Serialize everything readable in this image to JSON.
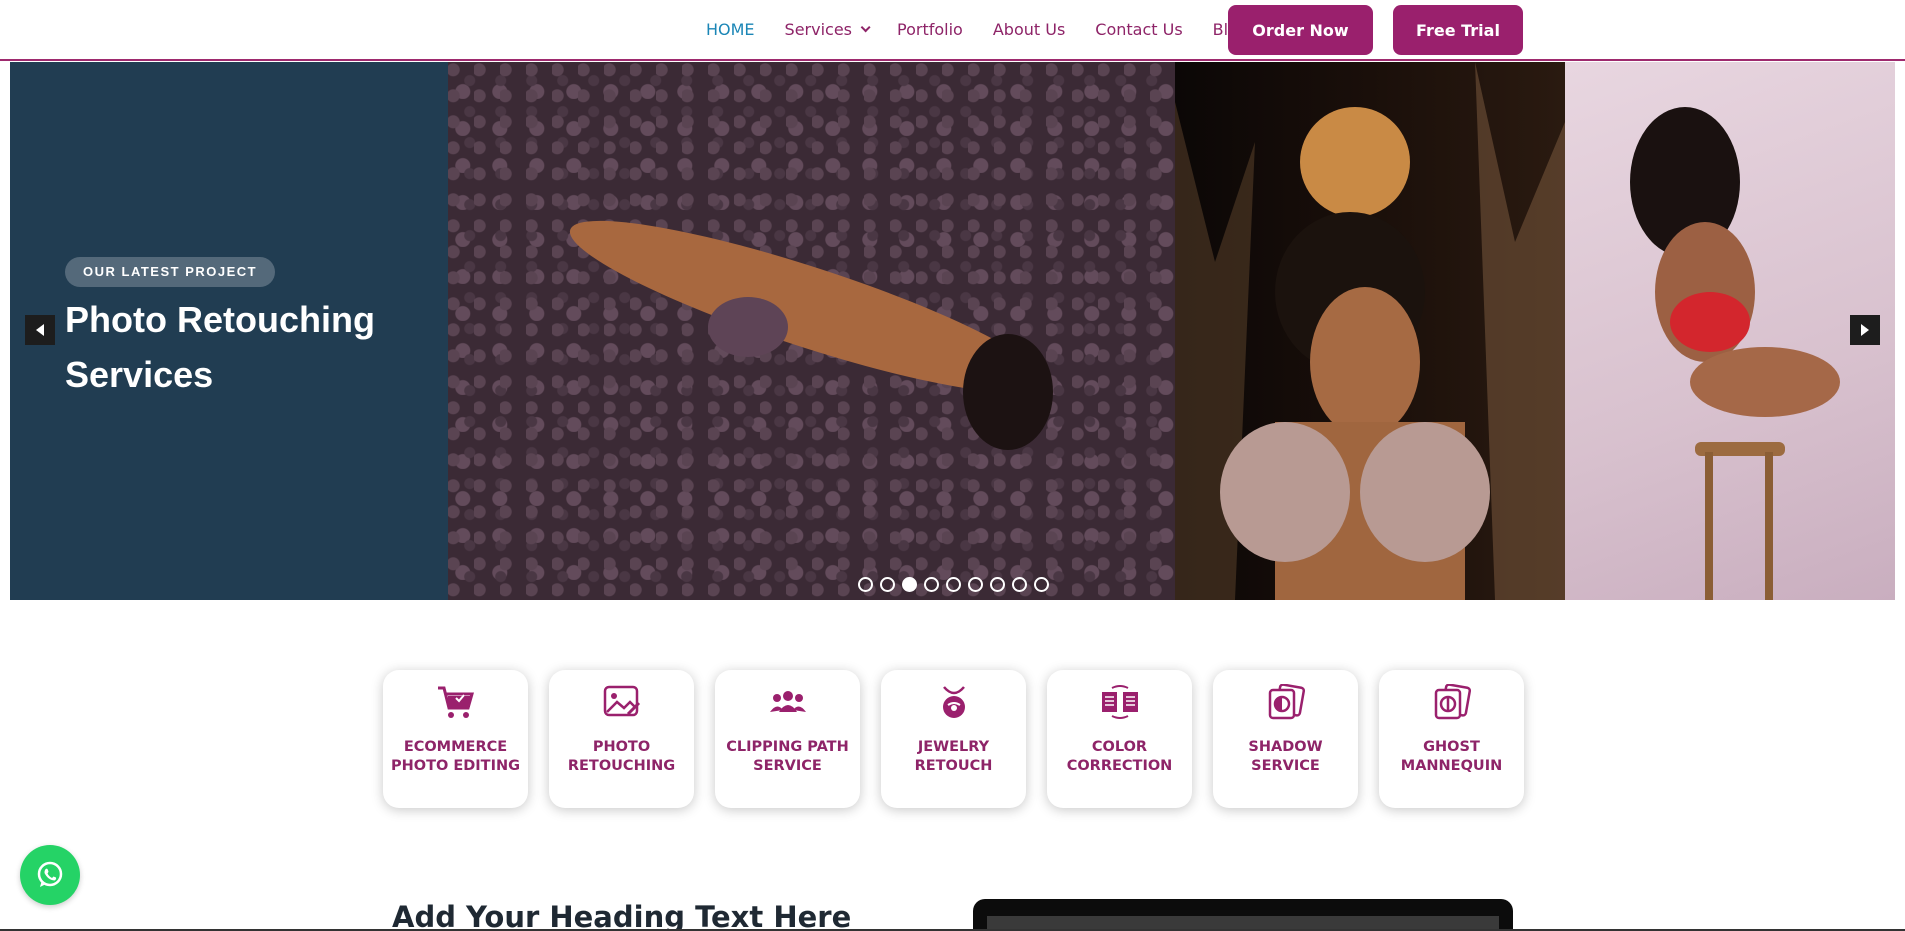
{
  "nav": {
    "items": [
      {
        "label": "HOME",
        "active": true
      },
      {
        "label": "Services",
        "dropdown": true
      },
      {
        "label": "Portfolio"
      },
      {
        "label": "About Us"
      },
      {
        "label": "Contact Us"
      },
      {
        "label": "Blog"
      }
    ],
    "order_label": "Order Now",
    "trial_label": "Free Trial"
  },
  "hero": {
    "eyebrow": "OUR LATEST PROJECT",
    "title": "Photo Retouching Services",
    "slide_count": 9,
    "active_slide": 3
  },
  "services": [
    {
      "label": "ECOMMERCE PHOTO EDITING",
      "icon": "shopping-cart-icon"
    },
    {
      "label": "PHOTO RETOUCHING",
      "icon": "image-edit-icon"
    },
    {
      "label": "CLIPPING PATH SERVICE",
      "icon": "people-group-icon"
    },
    {
      "label": "JEWELRY RETOUCH",
      "icon": "necklace-icon"
    },
    {
      "label": "COLOR CORRECTION",
      "icon": "color-swap-icon"
    },
    {
      "label": "SHADOW SERVICE",
      "icon": "shadow-layers-icon"
    },
    {
      "label": "GHOST MANNEQUIN",
      "icon": "ghost-mannequin-icon"
    }
  ],
  "section": {
    "heading": "Add Your Heading Text Here"
  },
  "colors": {
    "brand": "#9a206d",
    "nav_text": "#8e2468",
    "nav_active": "#1b86b6",
    "hero_bg": "#213d52",
    "whatsapp": "#25d366"
  }
}
